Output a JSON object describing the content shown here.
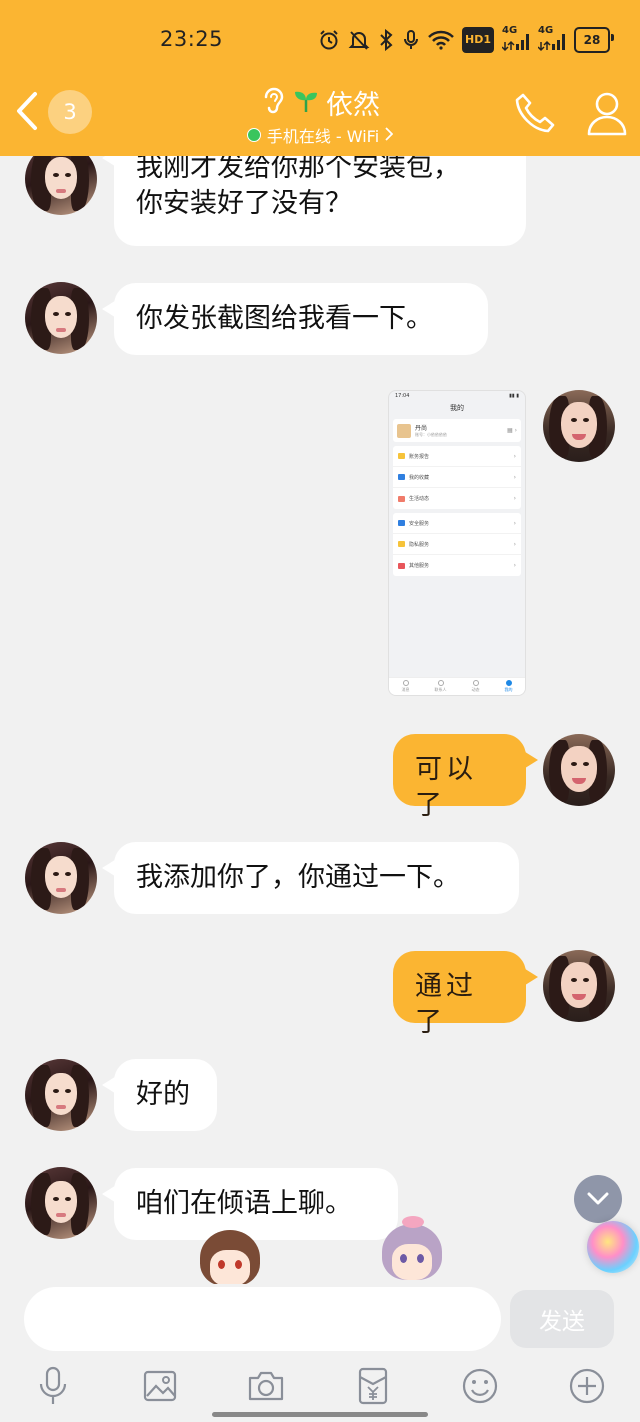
{
  "status_bar": {
    "time": "23:25",
    "hd_label": "HD1",
    "net1": "4G",
    "net2": "4G",
    "battery": "28"
  },
  "header": {
    "unread_count": "3",
    "contact_name": "依然",
    "online_status": "手机在线 - WiFi",
    "accent_color": "#fbb532",
    "online_color": "#3ac55d"
  },
  "messages": [
    {
      "side": "in",
      "text": "我刚才发给你那个安装包，\n你安装好了没有？"
    },
    {
      "side": "in",
      "text": "你发张截图给我看一下。"
    },
    {
      "side": "out",
      "type": "image",
      "image": {
        "status_time": "17:04",
        "page_title": "我的",
        "user_name": "丹尚",
        "user_sub": "账号：小依依依依",
        "group1": [
          "账务报告",
          "我的收藏",
          "生活动态"
        ],
        "group2": [
          "安全服务",
          "隐私服务",
          "其他服务"
        ],
        "tabs": [
          "消息",
          "联系人",
          "动态",
          "我的"
        ]
      }
    },
    {
      "side": "out",
      "text": "可以了"
    },
    {
      "side": "in",
      "text": "我添加你了，你通过一下。"
    },
    {
      "side": "out",
      "text": "通过了"
    },
    {
      "side": "in",
      "text": "好的"
    },
    {
      "side": "in",
      "text": "咱们在倾语上聊。"
    }
  ],
  "composer": {
    "input_value": "",
    "send_label": "发送"
  },
  "toolbar": {
    "icons": [
      "microphone-icon",
      "image-icon",
      "camera-icon",
      "red-packet-icon",
      "emoji-icon",
      "plus-icon"
    ]
  }
}
